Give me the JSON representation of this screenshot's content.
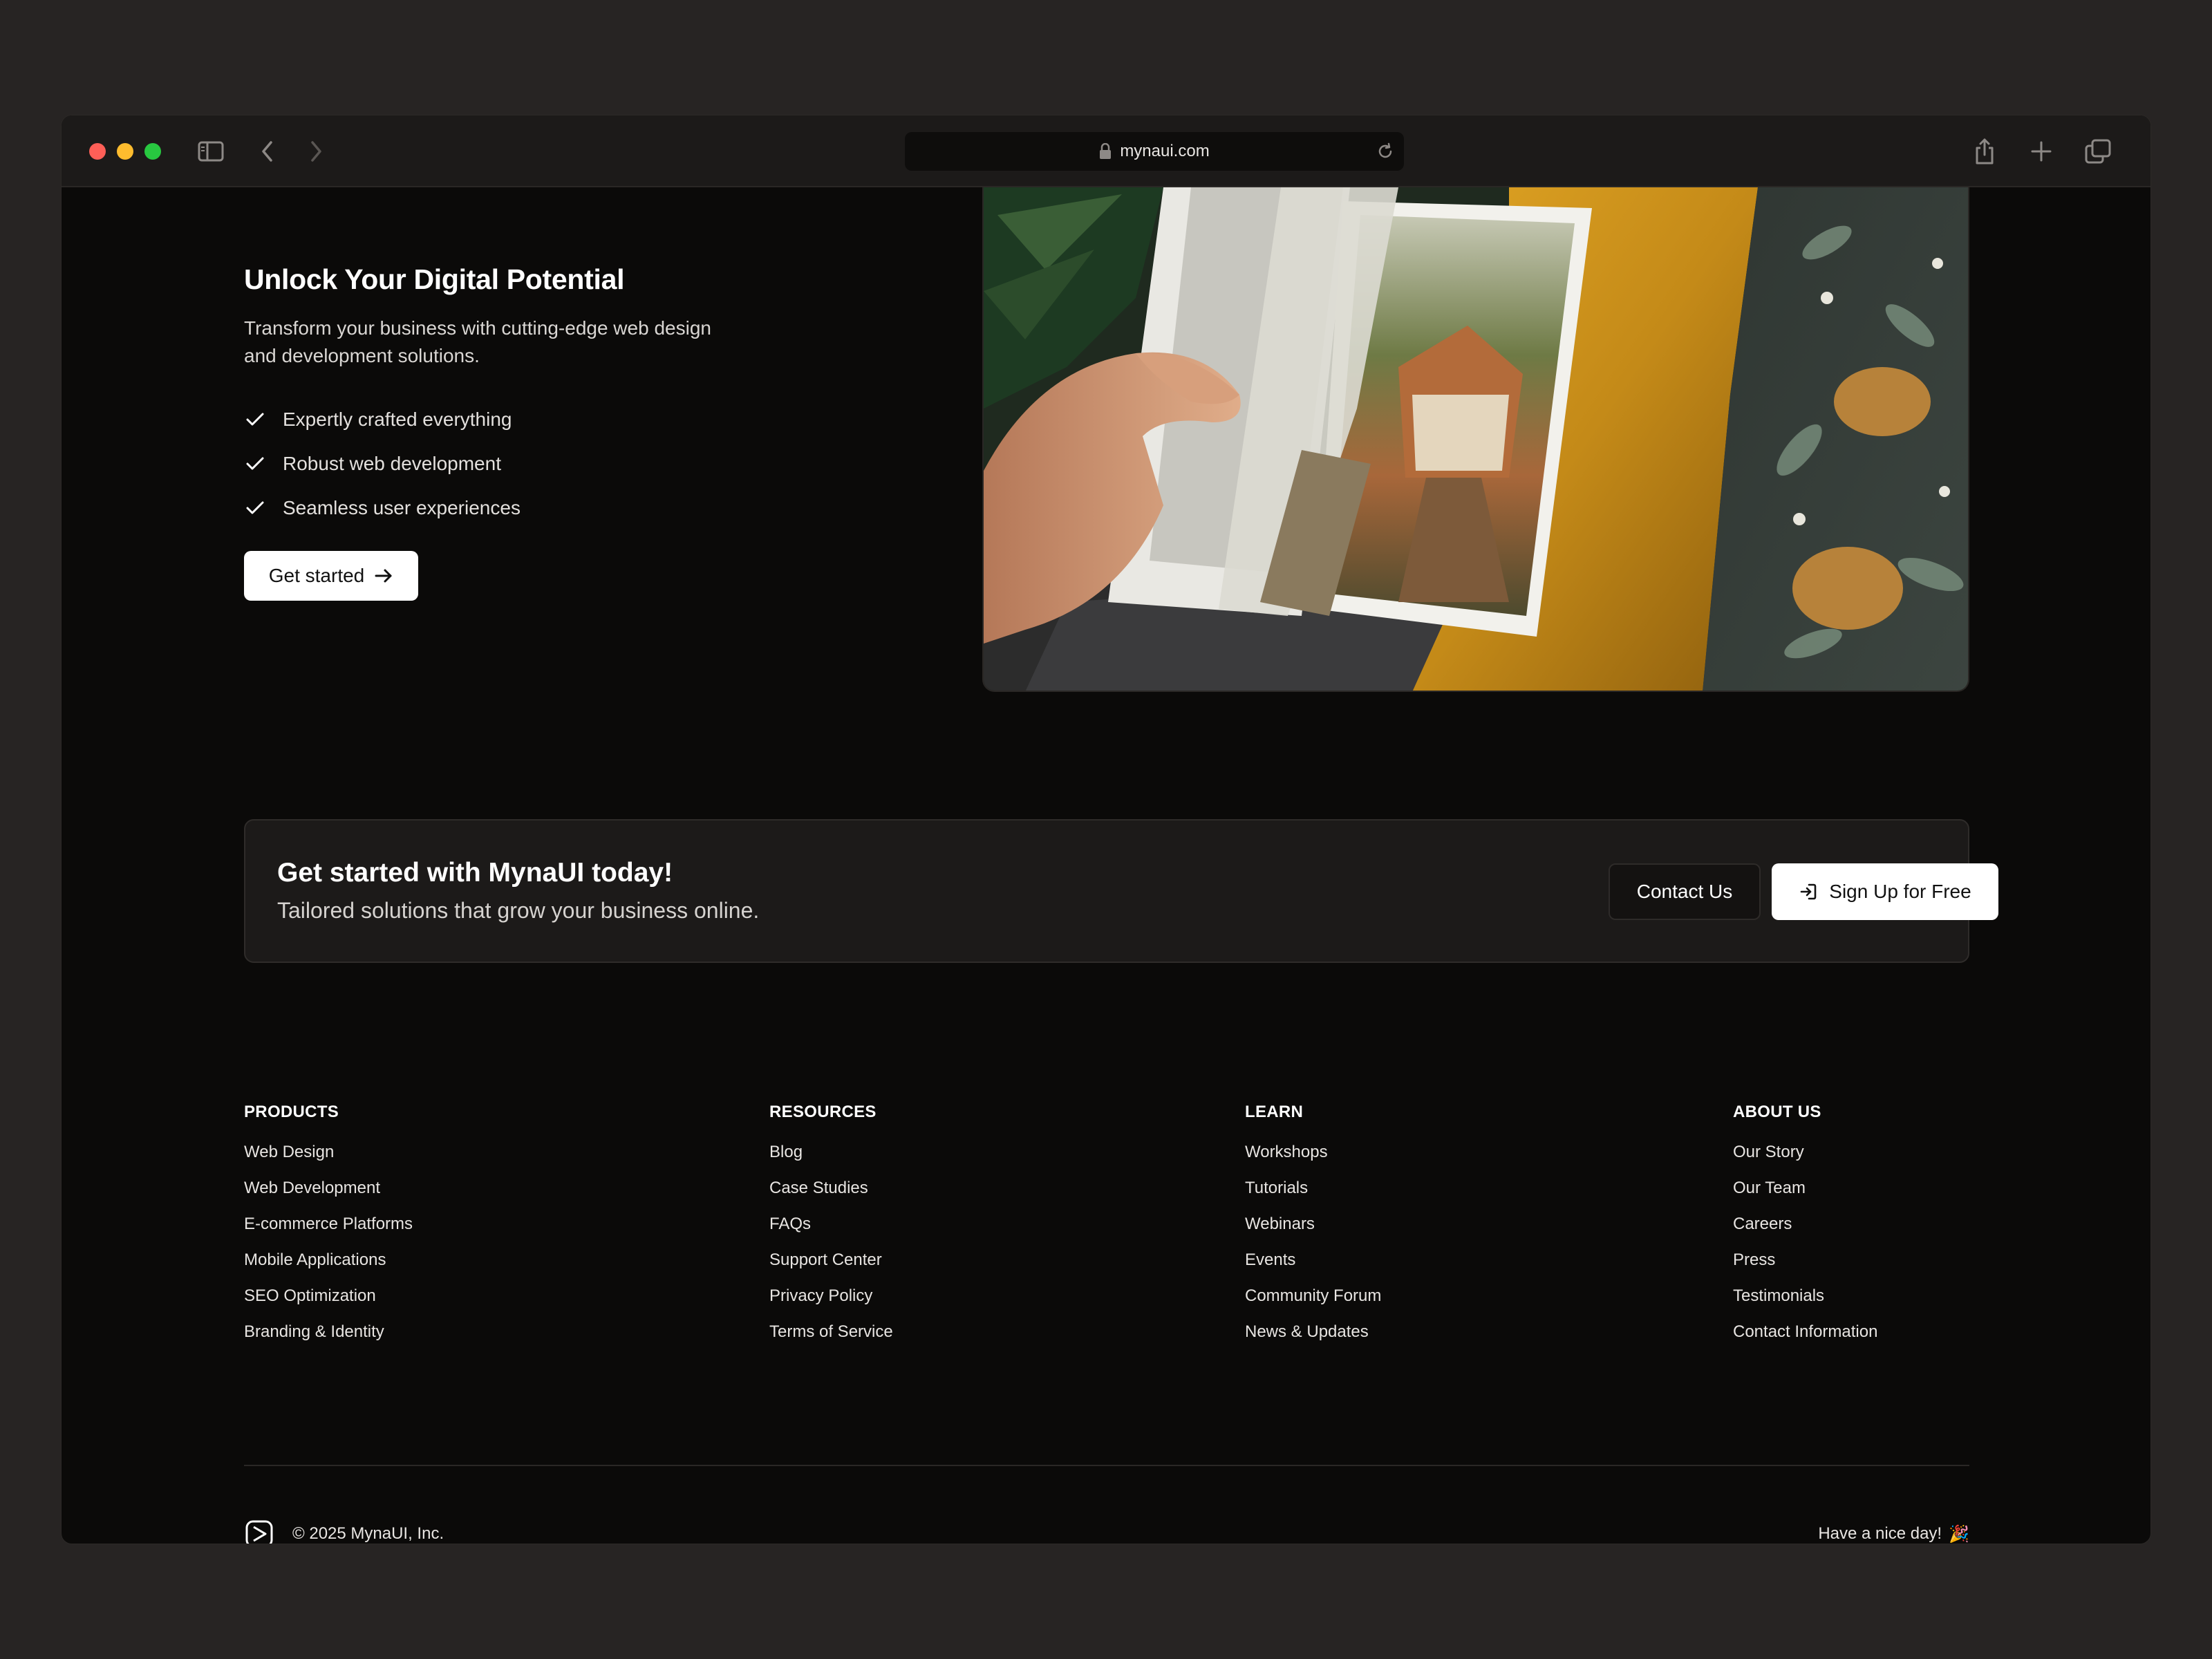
{
  "browser": {
    "url": "mynaui.com"
  },
  "hero": {
    "title": "Unlock Your Digital Potential",
    "subtitle": "Transform your business with cutting-edge web design and development solutions.",
    "features": [
      "Expertly crafted everything",
      "Robust web development",
      "Seamless user experiences"
    ],
    "cta_label": "Get started"
  },
  "cta": {
    "title": "Get started with MynaUI today!",
    "subtitle": "Tailored solutions that grow your business online.",
    "contact_label": "Contact Us",
    "signup_label": "Sign Up for Free"
  },
  "footer": {
    "columns": [
      {
        "heading": "PRODUCTS",
        "links": [
          "Web Design",
          "Web Development",
          "E-commerce Platforms",
          "Mobile Applications",
          "SEO Optimization",
          "Branding & Identity"
        ]
      },
      {
        "heading": "RESOURCES",
        "links": [
          "Blog",
          "Case Studies",
          "FAQs",
          "Support Center",
          "Privacy Policy",
          "Terms of Service"
        ]
      },
      {
        "heading": "LEARN",
        "links": [
          "Workshops",
          "Tutorials",
          "Webinars",
          "Events",
          "Community Forum",
          "News & Updates"
        ]
      },
      {
        "heading": "ABOUT US",
        "links": [
          "Our Story",
          "Our Team",
          "Careers",
          "Press",
          "Testimonials",
          "Contact Information"
        ]
      }
    ],
    "copyright": "© 2025 MynaUI, Inc.",
    "tagline": "Have a nice day!",
    "tagline_emoji": "🎉"
  },
  "colors": {
    "page_background": "#272423",
    "window_background": "#0b0a09",
    "titlebar": "#1c1a19",
    "primary_button": "#ffffff",
    "mustard": "#c8901a"
  },
  "icons": {
    "titlebar": [
      "sidebar-icon",
      "back-chevron-icon",
      "forward-chevron-icon",
      "lock-icon",
      "reload-icon",
      "share-icon",
      "plus-icon",
      "tabs-icon"
    ],
    "hero": [
      "check-icon",
      "arrow-right-icon"
    ],
    "cta": [
      "sign-in-icon"
    ],
    "footer": [
      "logo-icon"
    ]
  }
}
